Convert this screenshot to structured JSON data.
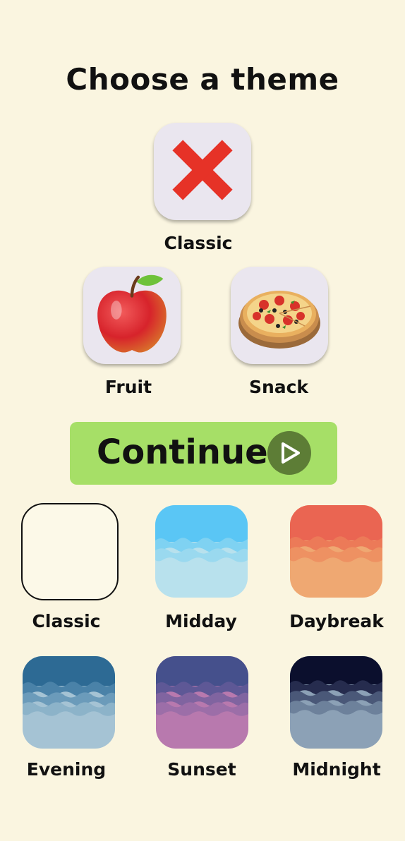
{
  "screen": {
    "title": "Choose a theme"
  },
  "piece_themes": [
    {
      "label": "Classic",
      "icon": "red-x-icon"
    },
    {
      "label": "Fruit",
      "icon": "apple-icon"
    },
    {
      "label": "Snack",
      "icon": "pizza-icon"
    }
  ],
  "continue_button": {
    "label": "Continue",
    "icon": "play-icon"
  },
  "color_themes": [
    {
      "label": "Classic",
      "colors": [
        "#fcf9e8"
      ]
    },
    {
      "label": "Midday",
      "colors": [
        "#5ac6f5",
        "#b8e1ed"
      ]
    },
    {
      "label": "Daybreak",
      "colors": [
        "#ea6552",
        "#efa872"
      ]
    },
    {
      "label": "Evening",
      "colors": [
        "#2d6a94",
        "#a5c3d4"
      ]
    },
    {
      "label": "Sunset",
      "colors": [
        "#45508c",
        "#b879ae"
      ]
    },
    {
      "label": "Midnight",
      "colors": [
        "#0b0f2d",
        "#8ca1b6"
      ]
    }
  ],
  "accent_colors": {
    "background": "#faf5e0",
    "continue_bg": "#a6df67",
    "play_circle": "#5d7d36",
    "x_red": "#e63227"
  }
}
